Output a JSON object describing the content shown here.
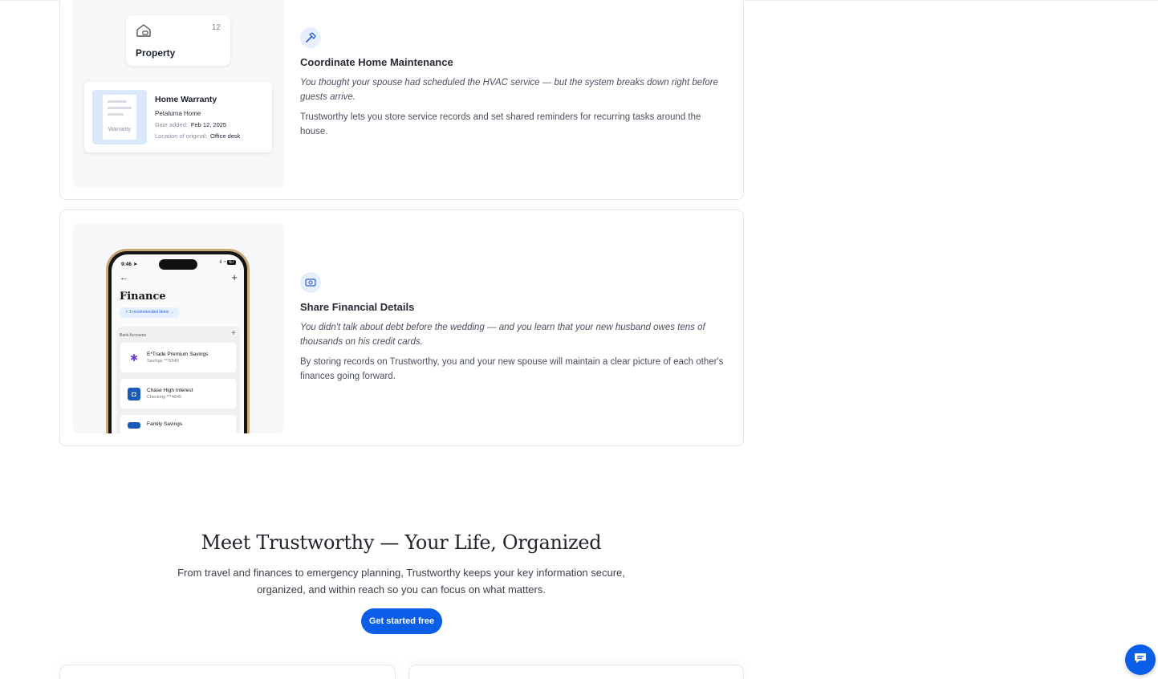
{
  "cards": [
    {
      "title": "Coordinate Home Maintenance",
      "scenario": "You thought your spouse had scheduled the HVAC service — but the system breaks down right before guests arrive.",
      "body": "Trustworthy lets you store service records and set shared reminders for recurring tasks around the house.",
      "icon": "hammer-icon",
      "property_tile": {
        "label": "Property",
        "count": "12",
        "icon": "house-icon"
      },
      "warranty": {
        "title": "Home Warranty",
        "subtitle": "Petaluma Home",
        "date_label": "Date added:",
        "date_value": "Feb 12, 2025",
        "location_label": "Location of original:",
        "location_value": "Office desk",
        "thumb_label": "Warranty"
      }
    },
    {
      "title": "Share Financial Details",
      "scenario": "You didn't talk about debt before the wedding — and you learn that your new husband owes tens of thousands on his credit cards.",
      "body": "By storing records on Trustworthy, you and your new spouse will maintain a clear picture of each other's finances going forward.",
      "icon": "money-icon",
      "phone": {
        "time": "9:46",
        "battery": "67",
        "screen_title": "Finance",
        "recommended": "3 recommended items",
        "section": "Bank Accounts",
        "accounts": [
          {
            "name": "E*Trade Premium Savings",
            "sub": "Savings ***6545"
          },
          {
            "name": "Chase High Interest",
            "sub": "Checking ***4845"
          },
          {
            "name": "Family Savings",
            "sub": ""
          }
        ]
      }
    }
  ],
  "cta": {
    "title": "Meet Trustworthy — Your Life, Organized",
    "body_line1": "From travel and finances to emergency planning, Trustworthy keeps your key information secure,",
    "body_line2": "organized, and within reach so you can focus on what matters.",
    "button": "Get started free"
  },
  "colors": {
    "accent": "#0b5ee8",
    "icon_bg": "#e7efff"
  },
  "chat_icon": "chat-icon"
}
